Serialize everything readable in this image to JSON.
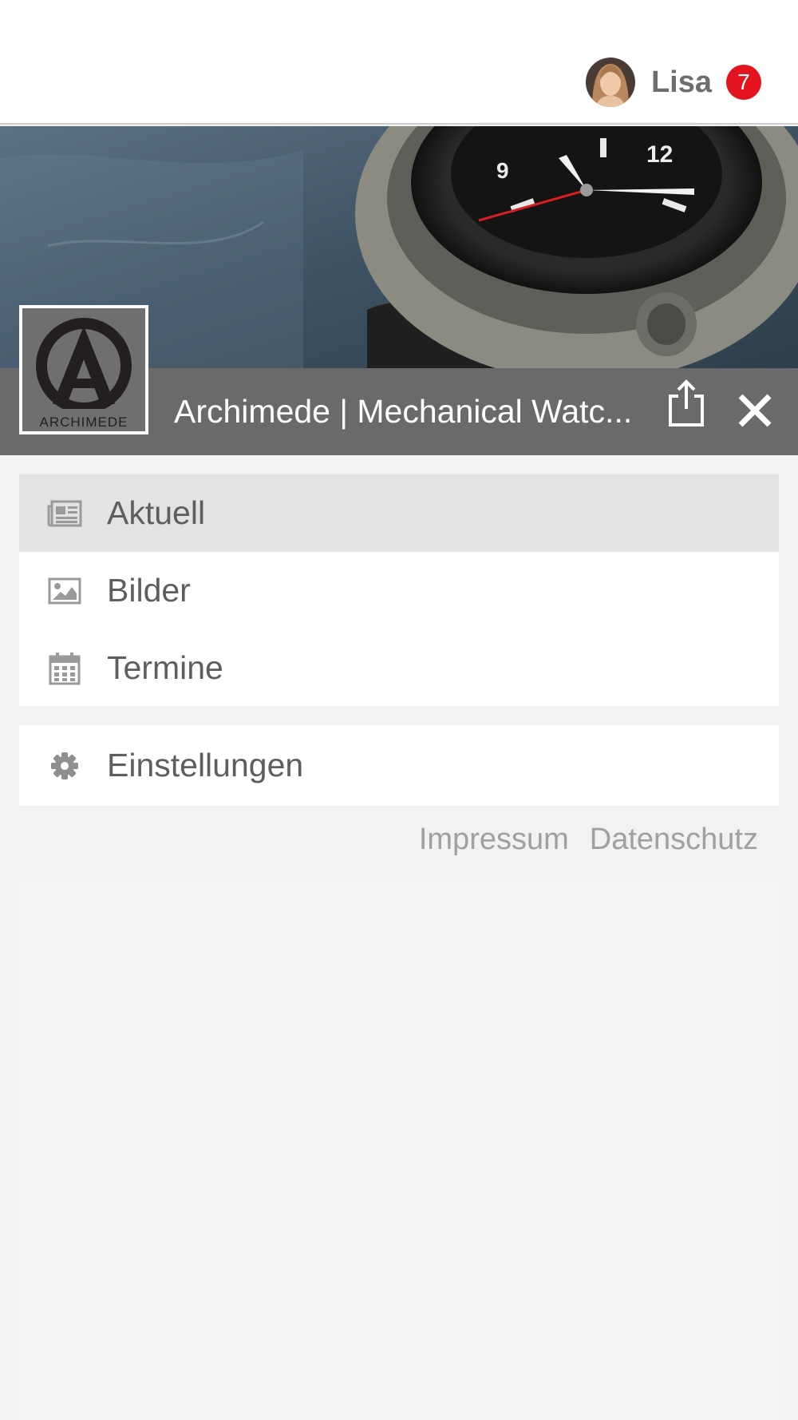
{
  "header": {
    "user_name": "Lisa",
    "notification_count": "7"
  },
  "page": {
    "title": "Archimede | Mechanical Watc...",
    "logo_text": "ARCHIMEDE",
    "accent_color": "#e3141e",
    "title_bar_color": "#6a6a6a"
  },
  "menu": {
    "items": [
      {
        "label": "Aktuell",
        "icon": "newspaper-icon",
        "active": true
      },
      {
        "label": "Bilder",
        "icon": "image-icon",
        "active": false
      },
      {
        "label": "Termine",
        "icon": "calendar-icon",
        "active": false
      }
    ],
    "settings": {
      "label": "Einstellungen",
      "icon": "gear-icon"
    }
  },
  "footer": {
    "impressum": "Impressum",
    "datenschutz": "Datenschutz"
  }
}
